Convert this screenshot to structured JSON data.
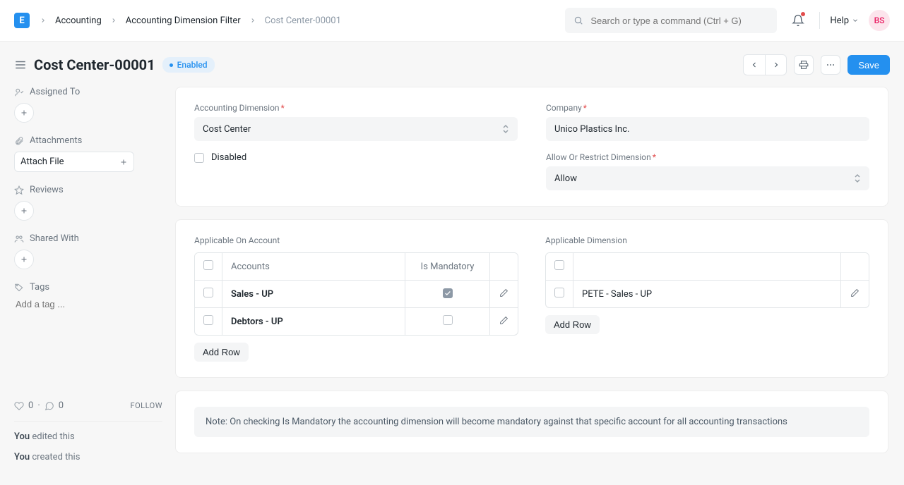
{
  "logo_letter": "E",
  "breadcrumb": {
    "items": [
      "Accounting",
      "Accounting Dimension Filter"
    ],
    "current": "Cost Center-00001"
  },
  "search": {
    "placeholder": "Search or type a command (Ctrl + G)"
  },
  "help_label": "Help",
  "avatar_initials": "BS",
  "page": {
    "title": "Cost Center-00001",
    "status": "Enabled",
    "save_label": "Save"
  },
  "sidebar": {
    "assigned_to": "Assigned To",
    "attachments": "Attachments",
    "attach_file": "Attach File",
    "reviews": "Reviews",
    "shared_with": "Shared With",
    "tags": "Tags",
    "add_tag_placeholder": "Add a tag ...",
    "likes": "0",
    "comments": "0",
    "follow": "FOLLOW",
    "activity": {
      "line1_who": "You",
      "line1_rest": " edited this",
      "line2_who": "You",
      "line2_rest": " created this"
    }
  },
  "form": {
    "accounting_dimension_label": "Accounting Dimension",
    "accounting_dimension_value": "Cost Center",
    "disabled_label": "Disabled",
    "disabled_checked": false,
    "company_label": "Company",
    "company_value": "Unico Plastics Inc.",
    "allow_restrict_label": "Allow Or Restrict Dimension",
    "allow_restrict_value": "Allow"
  },
  "tables": {
    "applicable_account": {
      "title": "Applicable On Account",
      "headers": {
        "accounts": "Accounts",
        "mandatory": "Is Mandatory"
      },
      "rows": [
        {
          "account": "Sales - UP",
          "mandatory": true
        },
        {
          "account": "Debtors - UP",
          "mandatory": false
        }
      ],
      "add_row": "Add Row"
    },
    "applicable_dimension": {
      "title": "Applicable Dimension",
      "headers": {
        "dimension": ""
      },
      "rows": [
        {
          "dimension": "PETE - Sales - UP"
        }
      ],
      "add_row": "Add Row"
    }
  },
  "note": "Note: On checking Is Mandatory the accounting dimension will become mandatory against that specific account for all accounting transactions"
}
